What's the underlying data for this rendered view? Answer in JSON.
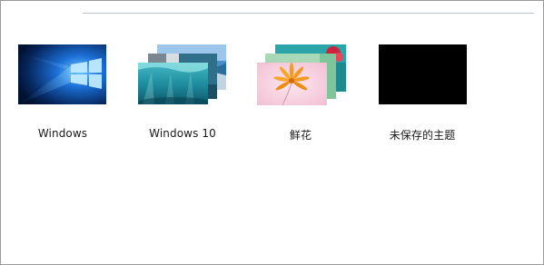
{
  "themes": [
    {
      "label": "Windows",
      "thumbnail": "windows-logo-blue-wallpaper"
    },
    {
      "label": "Windows 10",
      "thumbnail": "underwater-coast-wallpaper-stack"
    },
    {
      "label": "鲜花",
      "thumbnail": "orange-flower-wallpaper-stack"
    },
    {
      "label": "未保存的主题",
      "thumbnail": "black-solid-wallpaper"
    }
  ],
  "colors": {
    "divider": "#b8c3d2",
    "windows_blue": "#0a4aa8",
    "sea_teal": "#1f8fa0",
    "flower_pink": "#f3c6d8",
    "unsaved_black": "#000000"
  }
}
